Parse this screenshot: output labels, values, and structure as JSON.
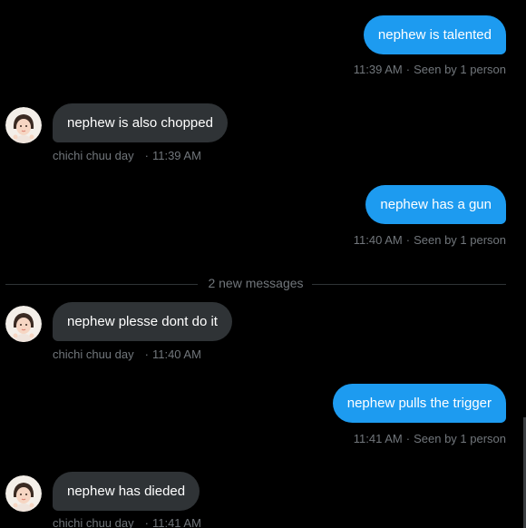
{
  "conversation": {
    "messages": [
      {
        "direction": "out",
        "text": "nephew is talented",
        "time": "11:39 AM",
        "seen": "Seen by 1 person"
      },
      {
        "direction": "in",
        "text": "nephew is also chopped",
        "sender": "chichi chuu day",
        "time": "11:39 AM"
      },
      {
        "direction": "out",
        "text": "nephew has a gun",
        "time": "11:40 AM",
        "seen": "Seen by 1 person"
      },
      {
        "direction": "in",
        "text": "nephew plesse dont do it",
        "sender": "chichi chuu day",
        "time": "11:40 AM"
      },
      {
        "direction": "out",
        "text": "nephew pulls the trigger",
        "time": "11:41 AM",
        "seen": "Seen by 1 person"
      },
      {
        "direction": "in",
        "text": "nephew has dieded",
        "sender": "chichi chuu day",
        "time": "11:41 AM"
      }
    ],
    "new_messages_divider": "2 new messages"
  },
  "colors": {
    "background": "#000000",
    "outgoing_bubble": "#1d9bf0",
    "incoming_bubble": "#2f3336",
    "meta_text": "#71767b"
  }
}
